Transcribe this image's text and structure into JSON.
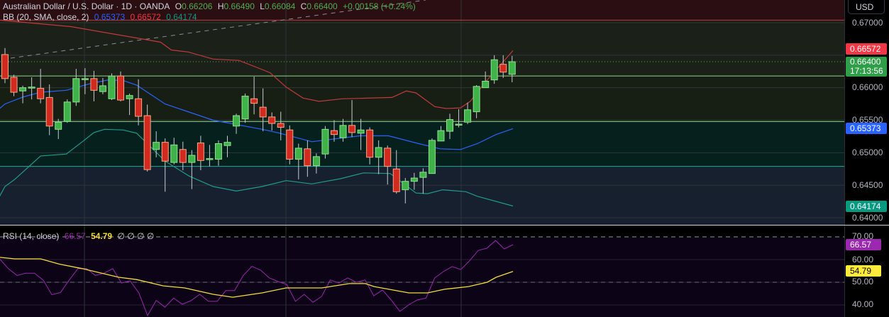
{
  "header": {
    "symbol": "Australian Dollar / U.S. Dollar · 1D · OANDA",
    "open_label": "O",
    "open": "0.66206",
    "high_label": "H",
    "high": "0.66490",
    "low_label": "L",
    "low": "0.66084",
    "close_label": "C",
    "close": "0.66400",
    "change": "+0.00158 (+0.24%)"
  },
  "bb_legend": {
    "label": "BB (20, SMA, close, 2)",
    "basis": "0.65373",
    "upper": "0.66572",
    "lower": "0.64174"
  },
  "rsi_legend": {
    "label": "RSI (14, close)",
    "rsi": "66.57",
    "ma": "54.79",
    "extras": "∅ ∅ ∅ ∅"
  },
  "axis": {
    "currency": "USD",
    "price_ticks": [
      "0.67000",
      "0.66000",
      "0.65500",
      "0.65000",
      "0.64500",
      "0.64000"
    ],
    "rsi_ticks": [
      "70.00",
      "60.00",
      "50.00",
      "40.00"
    ],
    "badges": {
      "upper": "0.66572",
      "last": "0.66400",
      "countdown": "17:13:56",
      "basis": "0.65373",
      "lower": "0.64174",
      "rsi": "66.57",
      "rsi_ma": "54.79"
    }
  },
  "colors": {
    "up": "#3fb34a",
    "down": "#d32a1f",
    "upper_band": "#f23645",
    "basis": "#2962ff",
    "lower_band": "#089981",
    "rsi": "#9c27b0",
    "rsi_ma": "#f5dc3c"
  },
  "chart_data": {
    "type": "candlestick",
    "price_range": [
      0.64,
      0.67
    ],
    "ohlc": [
      [
        0.6651,
        0.6661,
        0.6607,
        0.6614
      ],
      [
        0.6616,
        0.662,
        0.6587,
        0.6593
      ],
      [
        0.6595,
        0.6603,
        0.6576,
        0.66
      ],
      [
        0.66,
        0.6616,
        0.6582,
        0.6601
      ],
      [
        0.6599,
        0.6629,
        0.6576,
        0.6583
      ],
      [
        0.6585,
        0.6605,
        0.6527,
        0.6541
      ],
      [
        0.6536,
        0.6552,
        0.6521,
        0.6547
      ],
      [
        0.6548,
        0.6582,
        0.6546,
        0.6578
      ],
      [
        0.6578,
        0.6629,
        0.6572,
        0.6614
      ],
      [
        0.6613,
        0.663,
        0.659,
        0.6614
      ],
      [
        0.6614,
        0.6626,
        0.6579,
        0.6596
      ],
      [
        0.6594,
        0.6615,
        0.659,
        0.6603
      ],
      [
        0.6583,
        0.6622,
        0.6581,
        0.6618
      ],
      [
        0.6618,
        0.6625,
        0.6579,
        0.6581
      ],
      [
        0.6583,
        0.6591,
        0.6558,
        0.6588
      ],
      [
        0.6583,
        0.6613,
        0.6542,
        0.6556
      ],
      [
        0.6557,
        0.6574,
        0.6471,
        0.6474
      ],
      [
        0.6505,
        0.6533,
        0.6493,
        0.6516
      ],
      [
        0.6516,
        0.6522,
        0.644,
        0.6487
      ],
      [
        0.6485,
        0.6523,
        0.6482,
        0.6512
      ],
      [
        0.6505,
        0.6517,
        0.6473,
        0.6485
      ],
      [
        0.6485,
        0.6504,
        0.6444,
        0.6496
      ],
      [
        0.6515,
        0.6526,
        0.6473,
        0.6488
      ],
      [
        0.649,
        0.6512,
        0.6479,
        0.6491
      ],
      [
        0.649,
        0.6519,
        0.648,
        0.6514
      ],
      [
        0.6511,
        0.6526,
        0.6493,
        0.6516
      ],
      [
        0.6541,
        0.656,
        0.6529,
        0.6557
      ],
      [
        0.6552,
        0.6591,
        0.6546,
        0.6587
      ],
      [
        0.6583,
        0.6617,
        0.6559,
        0.6576
      ],
      [
        0.657,
        0.6599,
        0.6533,
        0.6555
      ],
      [
        0.6555,
        0.6562,
        0.6534,
        0.6545
      ],
      [
        0.6545,
        0.6563,
        0.6519,
        0.6539
      ],
      [
        0.6535,
        0.6542,
        0.6482,
        0.649
      ],
      [
        0.649,
        0.6514,
        0.6459,
        0.6507
      ],
      [
        0.6506,
        0.6519,
        0.6463,
        0.648
      ],
      [
        0.648,
        0.6499,
        0.6468,
        0.6494
      ],
      [
        0.6498,
        0.6541,
        0.6491,
        0.6536
      ],
      [
        0.6534,
        0.655,
        0.6517,
        0.6528
      ],
      [
        0.6523,
        0.6552,
        0.6517,
        0.6542
      ],
      [
        0.6542,
        0.6581,
        0.6524,
        0.6531
      ],
      [
        0.653,
        0.6552,
        0.6504,
        0.6535
      ],
      [
        0.6535,
        0.6539,
        0.6482,
        0.6493
      ],
      [
        0.6493,
        0.6519,
        0.6467,
        0.6508
      ],
      [
        0.6507,
        0.6511,
        0.6451,
        0.6479
      ],
      [
        0.6475,
        0.6504,
        0.6437,
        0.644
      ],
      [
        0.6443,
        0.6461,
        0.6422,
        0.6456
      ],
      [
        0.6456,
        0.6469,
        0.6443,
        0.6461
      ],
      [
        0.6462,
        0.6476,
        0.6437,
        0.647
      ],
      [
        0.6468,
        0.6522,
        0.6468,
        0.6519
      ],
      [
        0.6518,
        0.6541,
        0.6518,
        0.6534
      ],
      [
        0.6533,
        0.656,
        0.6521,
        0.6551
      ],
      [
        0.6543,
        0.6567,
        0.6539,
        0.6544
      ],
      [
        0.6547,
        0.6577,
        0.6544,
        0.6566
      ],
      [
        0.6563,
        0.6604,
        0.6553,
        0.6602
      ],
      [
        0.66,
        0.6625,
        0.66,
        0.661
      ],
      [
        0.6612,
        0.665,
        0.6606,
        0.6643
      ],
      [
        0.6636,
        0.665,
        0.6615,
        0.6624
      ],
      [
        0.66206,
        0.6649,
        0.66084,
        0.664
      ]
    ],
    "bb_upper": [
      [
        -0.6,
        0.6704
      ],
      [
        7.4,
        0.6694
      ],
      [
        15.4,
        0.6675
      ],
      [
        17.5,
        0.667
      ],
      [
        18.7,
        0.6658
      ],
      [
        20.6,
        0.6655
      ],
      [
        23.4,
        0.6644
      ],
      [
        26.3,
        0.6642
      ],
      [
        28.9,
        0.6628
      ],
      [
        29.8,
        0.6623
      ],
      [
        31.6,
        0.6601
      ],
      [
        33.5,
        0.6584
      ],
      [
        35.3,
        0.6579
      ],
      [
        37.9,
        0.6583
      ],
      [
        43.5,
        0.6585
      ],
      [
        45.1,
        0.6595
      ],
      [
        46.2,
        0.6592
      ],
      [
        48.3,
        0.6571
      ],
      [
        49.6,
        0.6568
      ],
      [
        51.2,
        0.6569
      ],
      [
        52.3,
        0.6579
      ],
      [
        54.2,
        0.6612
      ],
      [
        57.1,
        0.6657
      ]
    ],
    "bb_basis": [
      [
        -0.6,
        0.6568
      ],
      [
        0,
        0.6575
      ],
      [
        2.1,
        0.6586
      ],
      [
        4.0,
        0.6593
      ],
      [
        6.9,
        0.6596
      ],
      [
        9.5,
        0.6606
      ],
      [
        11.6,
        0.6612
      ],
      [
        13.3,
        0.6611
      ],
      [
        14.8,
        0.6604
      ],
      [
        18.0,
        0.6575
      ],
      [
        23.4,
        0.655
      ],
      [
        28.9,
        0.6536
      ],
      [
        30.6,
        0.6531
      ],
      [
        34.5,
        0.6517
      ],
      [
        39.9,
        0.6526
      ],
      [
        43.1,
        0.6526
      ],
      [
        46.5,
        0.6514
      ],
      [
        48.9,
        0.6506
      ],
      [
        51.2,
        0.6505
      ],
      [
        53.1,
        0.6514
      ],
      [
        55.2,
        0.6528
      ],
      [
        57.1,
        0.6537
      ]
    ],
    "bb_lower": [
      [
        -0.6,
        0.6433
      ],
      [
        0,
        0.6448
      ],
      [
        1.1,
        0.6459
      ],
      [
        4.0,
        0.6495
      ],
      [
        6.9,
        0.6498
      ],
      [
        8.7,
        0.6517
      ],
      [
        10.0,
        0.6531
      ],
      [
        11.2,
        0.6536
      ],
      [
        13.3,
        0.6535
      ],
      [
        14.8,
        0.653
      ],
      [
        18.0,
        0.6487
      ],
      [
        20.7,
        0.6464
      ],
      [
        23.4,
        0.6448
      ],
      [
        26.0,
        0.6441
      ],
      [
        28.9,
        0.6448
      ],
      [
        31.6,
        0.6457
      ],
      [
        34.5,
        0.6452
      ],
      [
        37.7,
        0.646
      ],
      [
        40.3,
        0.6469
      ],
      [
        43.3,
        0.6468
      ],
      [
        46.2,
        0.6438
      ],
      [
        47.5,
        0.6437
      ],
      [
        49.2,
        0.6443
      ],
      [
        51.8,
        0.644
      ],
      [
        53.1,
        0.6433
      ],
      [
        57.1,
        0.6418
      ]
    ],
    "levels": {
      "red": 0.6704,
      "green_1": 0.6618,
      "green_2": 0.6548,
      "teal": 0.6479,
      "last": 0.664
    },
    "rsi_range": [
      35,
      75
    ],
    "rsi": [
      60.3,
      56,
      53,
      54,
      54,
      51,
      44.5,
      45.5,
      51,
      56,
      56,
      53,
      54,
      56,
      49.7,
      50.6,
      45.3,
      35.3,
      42,
      39,
      43,
      40.3,
      41.9,
      44.7,
      41.6,
      41.6,
      46.3,
      46.3,
      53,
      57,
      55.3,
      51.9,
      50.3,
      49,
      41.6,
      44.7,
      41.2,
      43.7,
      51,
      49.7,
      51.9,
      50,
      51,
      44,
      46.6,
      42.2,
      37.2,
      40,
      42.2,
      43,
      51.9,
      54.7,
      56.9,
      55.6,
      59.4,
      64,
      65,
      68.4,
      64.7,
      66.57
    ],
    "rsi_ma": [
      [
        -0.6,
        61
      ],
      [
        1.1,
        60.3
      ],
      [
        4.0,
        60.3
      ],
      [
        6.1,
        58
      ],
      [
        8.7,
        56
      ],
      [
        12.8,
        52.2
      ],
      [
        14.8,
        51.2
      ],
      [
        17.8,
        48.4
      ],
      [
        20.2,
        47.5
      ],
      [
        23.4,
        44.7
      ],
      [
        25.6,
        43.4
      ],
      [
        28.9,
        45.3
      ],
      [
        31.6,
        47.5
      ],
      [
        35.6,
        47.5
      ],
      [
        38.7,
        49.4
      ],
      [
        40.5,
        49.4
      ],
      [
        41.5,
        48.1
      ],
      [
        45.4,
        45.3
      ],
      [
        47.5,
        45.3
      ],
      [
        49.4,
        46.9
      ],
      [
        52.1,
        48.1
      ],
      [
        54.2,
        50
      ],
      [
        55.2,
        52.2
      ],
      [
        57.1,
        54.79
      ]
    ]
  }
}
